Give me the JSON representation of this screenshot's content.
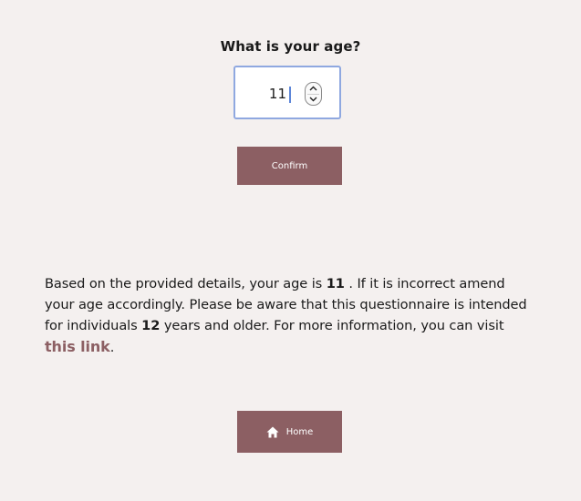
{
  "question": {
    "label": "What is your age?"
  },
  "age_input": {
    "value": "11"
  },
  "confirm_button": {
    "label": "Confirm"
  },
  "info": {
    "part1": "Based on the provided details, your age is ",
    "age": "11",
    "part2": " . If it is incorrect amend your age accordingly. Please be aware that this questionnaire is intended for individuals ",
    "min_age": "12",
    "part3": " years and older. For more information, you can visit ",
    "link_text": "this link",
    "part4": "."
  },
  "home_button": {
    "label": "Home",
    "icon": "home-icon"
  },
  "colors": {
    "background": "#f4f0ef",
    "accent": "#8c5f63",
    "input_border": "#8fa8e0"
  }
}
